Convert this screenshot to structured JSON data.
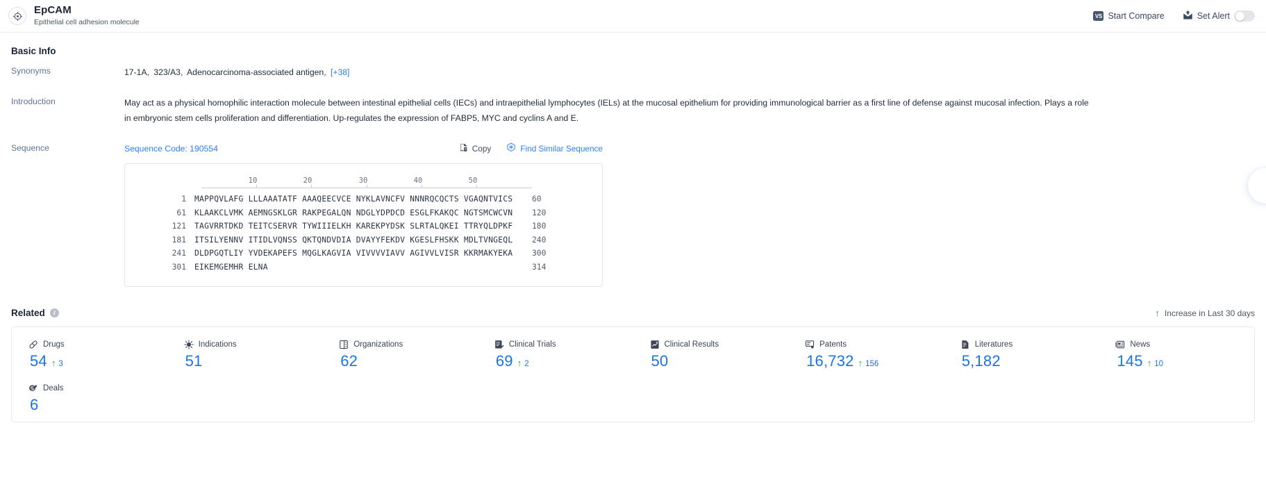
{
  "header": {
    "logo_icon": "target-crosshair-icon",
    "title": "EpCAM",
    "subtitle": "Epithelial cell adhesion molecule",
    "start_compare": {
      "label": "Start Compare",
      "badge": "VS",
      "icon": "vs-compare-icon"
    },
    "set_alert": {
      "label": "Set Alert",
      "icon": "alert-mail-icon",
      "toggle_on": false
    }
  },
  "basic_info": {
    "heading": "Basic Info",
    "synonyms": {
      "label": "Synonyms",
      "items": [
        "17-1A,",
        "323/A3,",
        "Adenocarcinoma-associated antigen,"
      ],
      "more": "[+38]"
    },
    "introduction": {
      "label": "Introduction",
      "text": "May act as a physical homophilic interaction molecule between intestinal epithelial cells (IECs) and intraepithelial lymphocytes (IELs) at the mucosal epithelium for providing immunological barrier as a first line of defense against mucosal infection. Plays a role in embryonic stem cells proliferation and differentiation. Up-regulates the expression of FABP5, MYC and cyclins A and E."
    },
    "sequence": {
      "label": "Sequence",
      "code_label": "Sequence Code: 190554",
      "copy_label": "Copy",
      "copy_icon": "copy-icon",
      "similar_label": "Find Similar Sequence",
      "similar_icon": "find-similar-icon",
      "ruler_ticks": [
        10,
        20,
        30,
        40,
        50
      ],
      "rows": [
        {
          "start": "1",
          "seq": "MAPPQVLAFG LLLAAATATF AAAQEECVCE NYKLAVNCFV NNNRQCQCTS VGAQNTVICS",
          "end": "60"
        },
        {
          "start": "61",
          "seq": "KLAAKCLVMK AEMNGSKLGR RAKPEGALQN NDGLYDPDCD ESGLFKAKQC NGTSMCWCVN",
          "end": "120"
        },
        {
          "start": "121",
          "seq": "TAGVRRTDKD TEITCSERVR TYWIIIELKH KAREKPYDSK SLRTALQKEI TTRYQLDPKF",
          "end": "180"
        },
        {
          "start": "181",
          "seq": "ITSILYENNV ITIDLVQNSS QKTQNDVDIA DVAYYFEKDV KGESLFHSKK MDLTVNGEQL",
          "end": "240"
        },
        {
          "start": "241",
          "seq": "DLDPGQTLIY YVDEKAPEFS MQGLKAGVIA VIVVVVIAVV AGIVVLVISR KKRMAKYEKA",
          "end": "300"
        },
        {
          "start": "301",
          "seq": "EIKEMGEMHR ELNA",
          "end": "314"
        }
      ]
    }
  },
  "related": {
    "heading": "Related",
    "info_icon": "info-icon",
    "legend": {
      "arrow": "↑",
      "label": "Increase in Last 30 days"
    },
    "cards": [
      {
        "label": "Drugs",
        "icon": "pill-icon",
        "value": "54",
        "delta": "3"
      },
      {
        "label": "Indications",
        "icon": "virus-icon",
        "value": "51",
        "delta": ""
      },
      {
        "label": "Organizations",
        "icon": "building-icon",
        "value": "62",
        "delta": ""
      },
      {
        "label": "Clinical Trials",
        "icon": "clinical-trial-icon",
        "value": "69",
        "delta": "2"
      },
      {
        "label": "Clinical Results",
        "icon": "clinical-result-icon",
        "value": "50",
        "delta": ""
      },
      {
        "label": "Patents",
        "icon": "patent-icon",
        "value": "16,732",
        "delta": "156"
      },
      {
        "label": "Literatures",
        "icon": "literature-icon",
        "value": "5,182",
        "delta": ""
      },
      {
        "label": "News",
        "icon": "news-icon",
        "value": "145",
        "delta": "10"
      },
      {
        "label": "Deals",
        "icon": "deals-icon",
        "value": "6",
        "delta": ""
      }
    ]
  },
  "colors": {
    "accent_blue": "#1a73e8",
    "link_blue": "#2d7ff9",
    "increase_green": "#21a243",
    "text_dark": "#1b2436",
    "label_gray": "#5e7491"
  }
}
